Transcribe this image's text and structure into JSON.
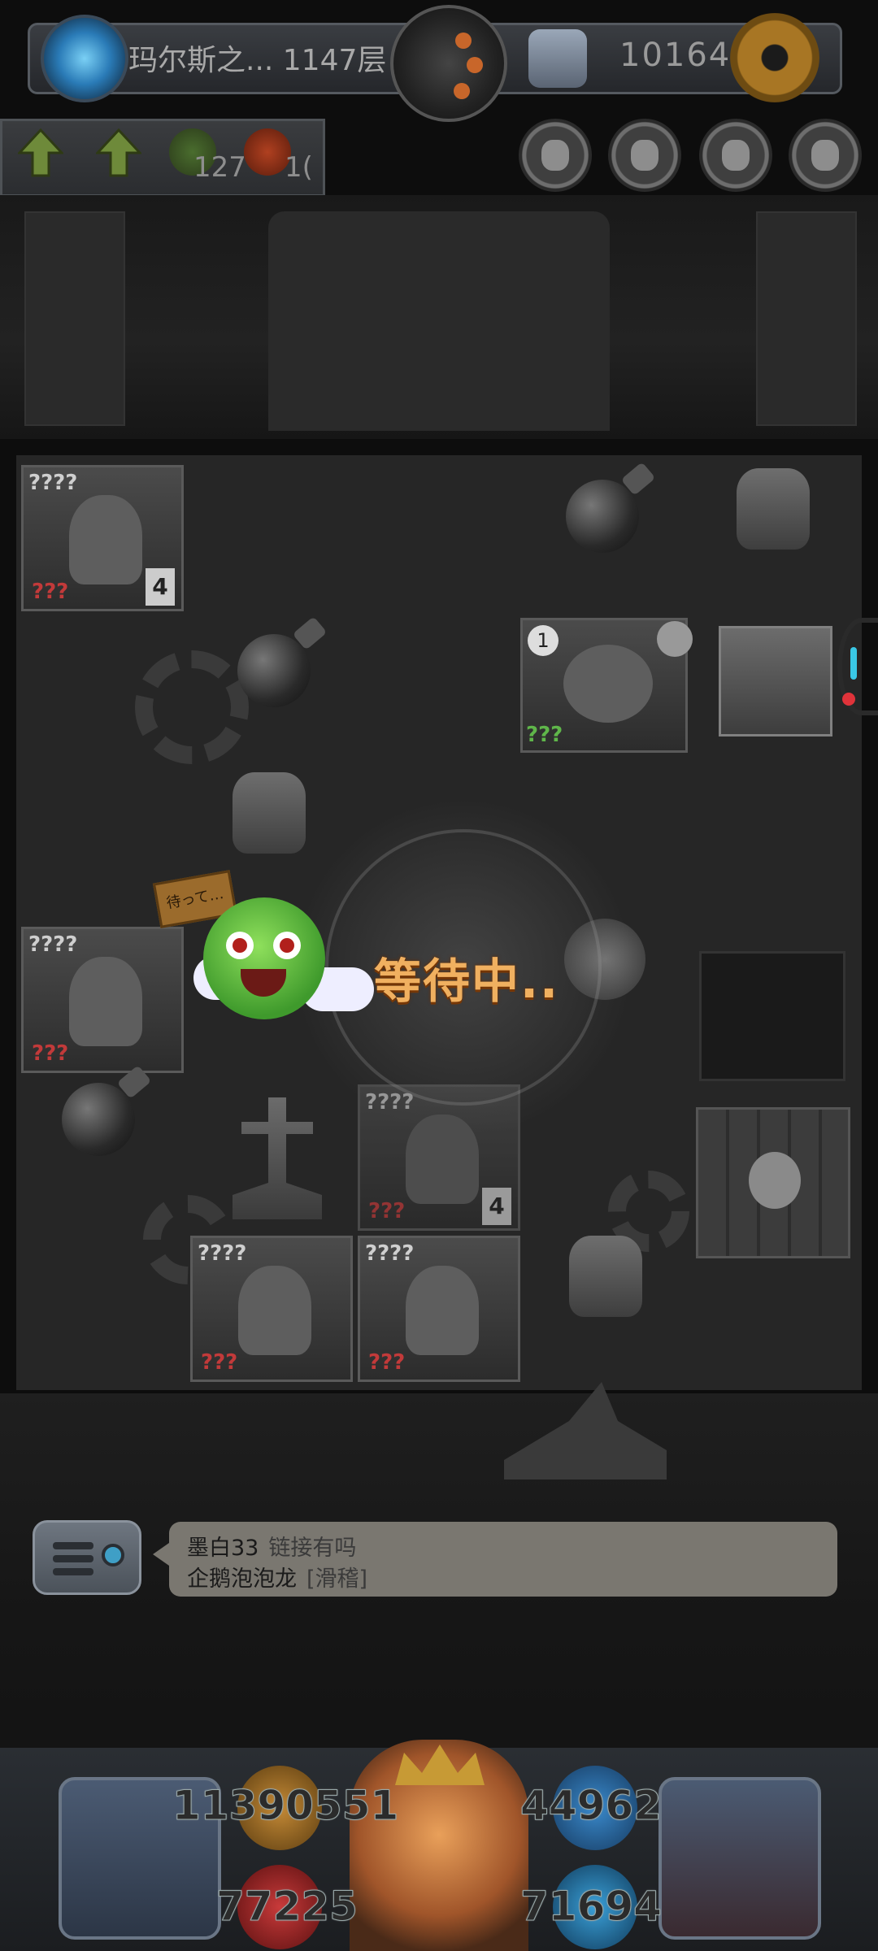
{
  "header": {
    "floor_label": "玛尔斯之... 1147层",
    "currency": "10164("
  },
  "resources": {
    "item_1": "127",
    "item_2": "1("
  },
  "board": {
    "card_unknown_name": "????",
    "card_unknown_stat": "???",
    "card_unknown_stat_green": "???",
    "tile_level_4": "4",
    "tile_level_1": "1"
  },
  "waiting": {
    "status_text": "等待中..",
    "sign_text": "待って…"
  },
  "chat": {
    "line1_user": "墨白33",
    "line1_message": "链接有吗",
    "line2_user": "企鹅泡泡龙",
    "line2_message": "[滑稽]"
  },
  "hud": {
    "stat_top_left": "11390551",
    "stat_top_right": "44962",
    "stat_bottom_left": "77225",
    "stat_bottom_right": "71694"
  },
  "colors": {
    "wait_text": "#f0b060",
    "accent_cyan": "#3ac8e6",
    "alert_red": "#e0333a"
  }
}
